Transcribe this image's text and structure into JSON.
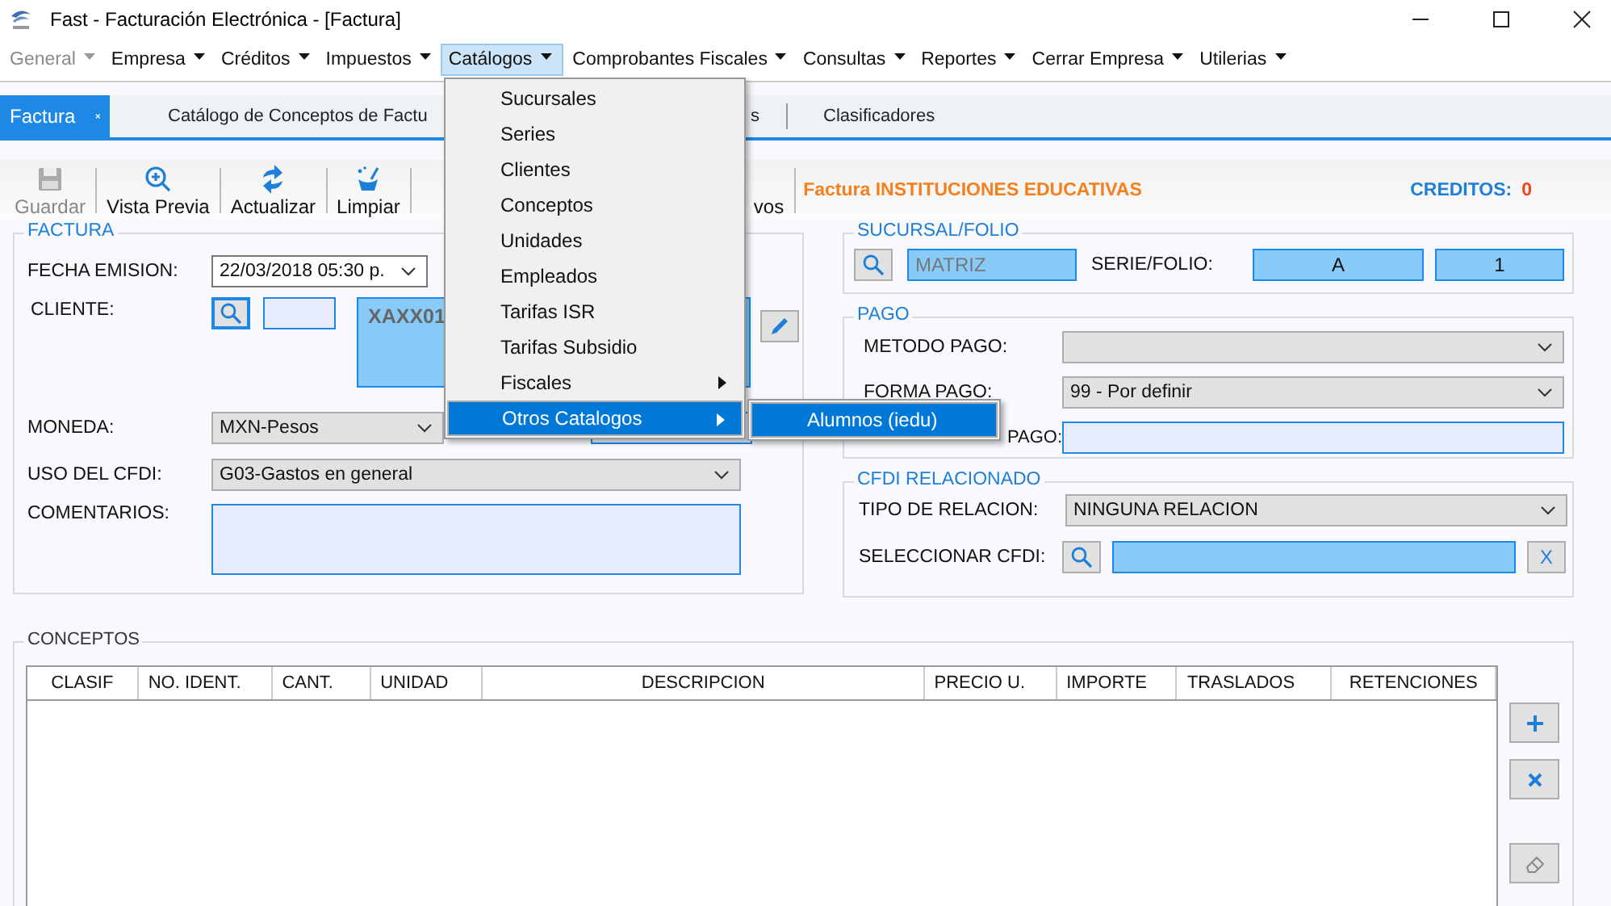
{
  "window": {
    "title": "Fast - Facturación Electrónica - [Factura]"
  },
  "menu_bar": [
    {
      "label": "General",
      "disabled": true,
      "selected": false
    },
    {
      "label": "Empresa",
      "disabled": false,
      "selected": false
    },
    {
      "label": "Créditos",
      "disabled": false,
      "selected": false
    },
    {
      "label": "Impuestos",
      "disabled": false,
      "selected": false
    },
    {
      "label": "Catálogos",
      "disabled": false,
      "selected": true
    },
    {
      "label": "Comprobantes Fiscales",
      "disabled": false,
      "selected": false
    },
    {
      "label": "Consultas",
      "disabled": false,
      "selected": false
    },
    {
      "label": "Reportes",
      "disabled": false,
      "selected": false
    },
    {
      "label": "Cerrar Empresa",
      "disabled": false,
      "selected": false
    },
    {
      "label": "Utilerias",
      "disabled": false,
      "selected": false
    }
  ],
  "catalogos_menu": {
    "items": [
      {
        "label": "Sucursales",
        "has_submenu": false,
        "selected": false
      },
      {
        "label": "Series",
        "has_submenu": false,
        "selected": false
      },
      {
        "label": "Clientes",
        "has_submenu": false,
        "selected": false
      },
      {
        "label": "Conceptos",
        "has_submenu": false,
        "selected": false
      },
      {
        "label": "Unidades",
        "has_submenu": false,
        "selected": false
      },
      {
        "label": "Empleados",
        "has_submenu": false,
        "selected": false
      },
      {
        "label": "Tarifas ISR",
        "has_submenu": false,
        "selected": false
      },
      {
        "label": "Tarifas Subsidio",
        "has_submenu": false,
        "selected": false
      },
      {
        "label": "Fiscales",
        "has_submenu": true,
        "selected": false
      },
      {
        "label": "Otros Catalogos",
        "has_submenu": true,
        "selected": true
      }
    ],
    "submenu": [
      {
        "label": "Alumnos (iedu)",
        "selected": true
      }
    ]
  },
  "tabs": [
    {
      "label": "Factura",
      "selected": true,
      "closable": true
    },
    {
      "label": "Catálogo de Conceptos de Factu",
      "selected": false,
      "closable": false
    },
    {
      "label": "s",
      "selected": false,
      "closable": false
    },
    {
      "label": "Clasificadores",
      "selected": false,
      "closable": false
    }
  ],
  "toolbar": {
    "buttons": [
      {
        "label": "Guardar",
        "disabled": true
      },
      {
        "label": "Vista Previa",
        "disabled": false
      },
      {
        "label": "Actualizar",
        "disabled": false
      },
      {
        "label": "Limpiar",
        "disabled": false
      },
      {
        "label": "vos",
        "disabled": false
      }
    ],
    "title": "Factura INSTITUCIONES EDUCATIVAS",
    "credits_label": "CREDITOS:",
    "credits_value": "0"
  },
  "factura": {
    "legend": "FACTURA",
    "fecha_label": "FECHA EMISION:",
    "fecha_value": "22/03/2018 05:30 p.",
    "cliente_label": "CLIENTE:",
    "cliente_name": "XAXX01",
    "moneda_label": "MONEDA:",
    "moneda_value": "MXN-Pesos",
    "uso_label": "USO DEL CFDI:",
    "uso_value": "G03-Gastos en general",
    "comentarios_label": "COMENTARIOS:"
  },
  "sucursal_folio": {
    "legend": "SUCURSAL/FOLIO",
    "sucursal": "MATRIZ",
    "serie_label": "SERIE/FOLIO:",
    "serie": "A",
    "folio": "1"
  },
  "pago": {
    "legend": "PAGO",
    "metodo_label": "METODO PAGO:",
    "forma_label": "FORMA PAGO:",
    "forma_value": "99 - Por definir",
    "condiciones_label": "PAGO:"
  },
  "cfdi_relacionado": {
    "legend": "CFDI RELACIONADO",
    "tipo_label": "TIPO DE RELACION:",
    "tipo_value": "NINGUNA RELACION",
    "seleccionar_label": "SELECCIONAR CFDI:",
    "clear_button": "X"
  },
  "conceptos": {
    "legend": "CONCEPTOS",
    "columns": [
      "CLASIF",
      "NO. IDENT.",
      "CANT.",
      "UNIDAD",
      "DESCRIPCION",
      "PRECIO U.",
      "IMPORTE",
      "TRASLADOS",
      "RETENCIONES"
    ]
  }
}
